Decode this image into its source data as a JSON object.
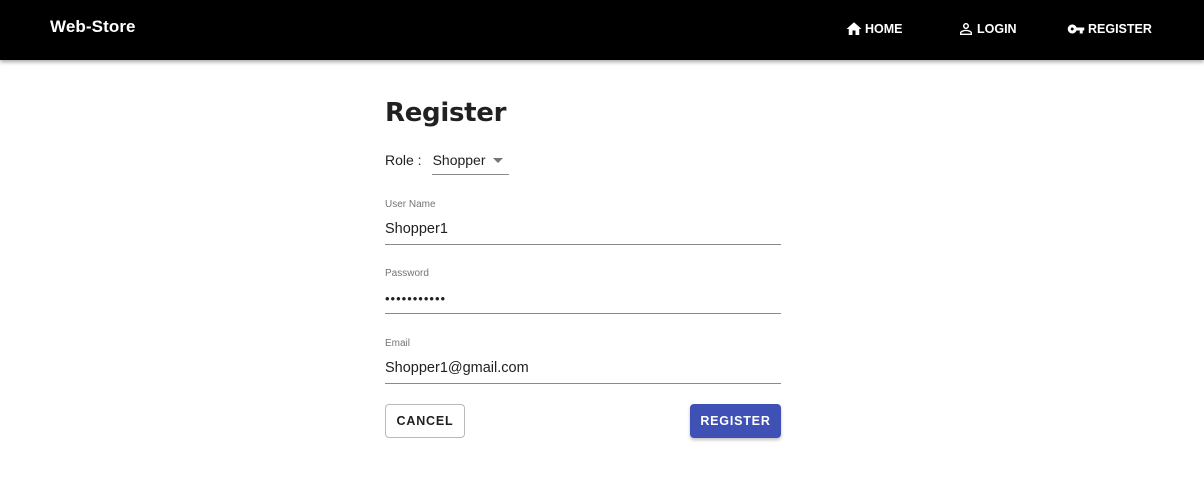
{
  "header": {
    "brand": "Web-Store",
    "nav": [
      {
        "label": "HOME",
        "icon": "home-icon"
      },
      {
        "label": "LOGIN",
        "icon": "person-icon"
      },
      {
        "label": "REGISTER",
        "icon": "key-icon"
      }
    ]
  },
  "form": {
    "title": "Register",
    "role": {
      "label": "Role :",
      "value": "Shopper"
    },
    "username": {
      "label": "User Name",
      "value": "Shopper1"
    },
    "password": {
      "label": "Password",
      "value": "•••••••••••"
    },
    "email": {
      "label": "Email",
      "value": "Shopper1@gmail.com"
    },
    "cancel_label": "CANCEL",
    "register_label": "REGISTER"
  },
  "colors": {
    "appbar": "#000000",
    "primary": "#3f51b5",
    "text": "#212121",
    "label": "#757575"
  }
}
